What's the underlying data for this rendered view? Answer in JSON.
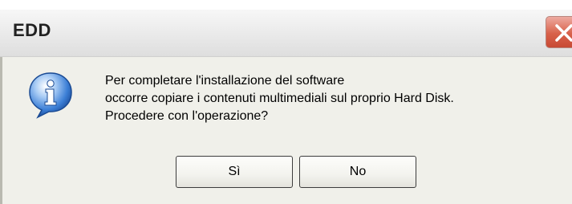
{
  "window": {
    "title": "EDD",
    "close_icon": "close-icon"
  },
  "dialog": {
    "icon": "info-icon",
    "message_lines": [
      "Per completare l'installazione del software",
      "occorre copiare i contenuti multimediali sul proprio Hard Disk.",
      "Procedere con l'operazione?"
    ]
  },
  "buttons": {
    "yes_label": "Sì",
    "no_label": "No"
  },
  "colors": {
    "client_background": "#f0f0ea",
    "close_button": "#d8614a",
    "info_icon": "#2f6fce"
  }
}
